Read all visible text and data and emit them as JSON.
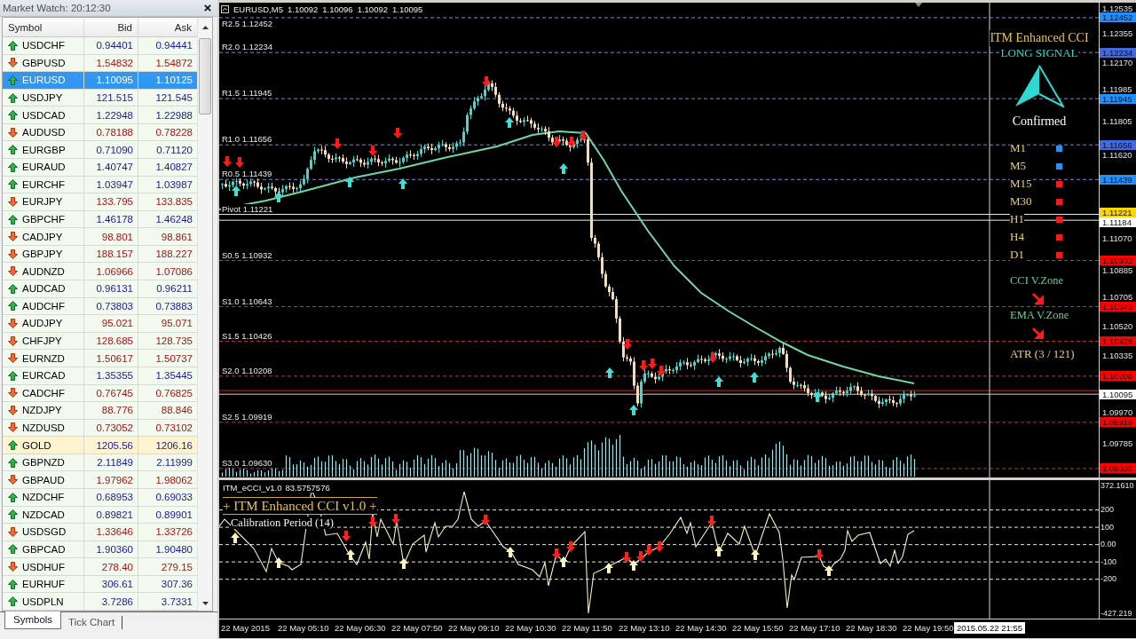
{
  "market_watch": {
    "title": "Market Watch: 20:12:30",
    "columns": [
      "Symbol",
      "Bid",
      "Ask"
    ],
    "rows": [
      {
        "symbol": "USDCHF",
        "bid": "0.94401",
        "ask": "0.94441",
        "rising": true,
        "selected": false,
        "highlighted": false
      },
      {
        "symbol": "GBPUSD",
        "bid": "1.54832",
        "ask": "1.54872",
        "rising": false,
        "selected": false,
        "highlighted": false
      },
      {
        "symbol": "EURUSD",
        "bid": "1.10095",
        "ask": "1.10125",
        "rising": true,
        "selected": true,
        "highlighted": false
      },
      {
        "symbol": "USDJPY",
        "bid": "121.515",
        "ask": "121.545",
        "rising": true,
        "selected": false,
        "highlighted": false
      },
      {
        "symbol": "USDCAD",
        "bid": "1.22948",
        "ask": "1.22988",
        "rising": true,
        "selected": false,
        "highlighted": false
      },
      {
        "symbol": "AUDUSD",
        "bid": "0.78188",
        "ask": "0.78228",
        "rising": false,
        "selected": false,
        "highlighted": false
      },
      {
        "symbol": "EURGBP",
        "bid": "0.71090",
        "ask": "0.71120",
        "rising": true,
        "selected": false,
        "highlighted": false
      },
      {
        "symbol": "EURAUD",
        "bid": "1.40747",
        "ask": "1.40827",
        "rising": true,
        "selected": false,
        "highlighted": false
      },
      {
        "symbol": "EURCHF",
        "bid": "1.03947",
        "ask": "1.03987",
        "rising": true,
        "selected": false,
        "highlighted": false
      },
      {
        "symbol": "EURJPY",
        "bid": "133.795",
        "ask": "133.835",
        "rising": false,
        "selected": false,
        "highlighted": false
      },
      {
        "symbol": "GBPCHF",
        "bid": "1.46178",
        "ask": "1.46248",
        "rising": true,
        "selected": false,
        "highlighted": false
      },
      {
        "symbol": "CADJPY",
        "bid": "98.801",
        "ask": "98.861",
        "rising": false,
        "selected": false,
        "highlighted": false
      },
      {
        "symbol": "GBPJPY",
        "bid": "188.157",
        "ask": "188.227",
        "rising": false,
        "selected": false,
        "highlighted": false
      },
      {
        "symbol": "AUDNZD",
        "bid": "1.06966",
        "ask": "1.07086",
        "rising": false,
        "selected": false,
        "highlighted": false
      },
      {
        "symbol": "AUDCAD",
        "bid": "0.96131",
        "ask": "0.96211",
        "rising": true,
        "selected": false,
        "highlighted": false
      },
      {
        "symbol": "AUDCHF",
        "bid": "0.73803",
        "ask": "0.73883",
        "rising": true,
        "selected": false,
        "highlighted": false
      },
      {
        "symbol": "AUDJPY",
        "bid": "95.021",
        "ask": "95.071",
        "rising": false,
        "selected": false,
        "highlighted": false
      },
      {
        "symbol": "CHFJPY",
        "bid": "128.685",
        "ask": "128.735",
        "rising": false,
        "selected": false,
        "highlighted": false
      },
      {
        "symbol": "EURNZD",
        "bid": "1.50617",
        "ask": "1.50737",
        "rising": false,
        "selected": false,
        "highlighted": false
      },
      {
        "symbol": "EURCAD",
        "bid": "1.35355",
        "ask": "1.35445",
        "rising": true,
        "selected": false,
        "highlighted": false
      },
      {
        "symbol": "CADCHF",
        "bid": "0.76745",
        "ask": "0.76825",
        "rising": false,
        "selected": false,
        "highlighted": false
      },
      {
        "symbol": "NZDJPY",
        "bid": "88.776",
        "ask": "88.846",
        "rising": false,
        "selected": false,
        "highlighted": false
      },
      {
        "symbol": "NZDUSD",
        "bid": "0.73052",
        "ask": "0.73102",
        "rising": false,
        "selected": false,
        "highlighted": false
      },
      {
        "symbol": "GOLD",
        "bid": "1205.56",
        "ask": "1206.16",
        "rising": true,
        "selected": false,
        "highlighted": true
      },
      {
        "symbol": "GBPNZD",
        "bid": "2.11849",
        "ask": "2.11999",
        "rising": true,
        "selected": false,
        "highlighted": false
      },
      {
        "symbol": "GBPAUD",
        "bid": "1.97962",
        "ask": "1.98062",
        "rising": false,
        "selected": false,
        "highlighted": false
      },
      {
        "symbol": "NZDCHF",
        "bid": "0.68953",
        "ask": "0.69033",
        "rising": true,
        "selected": false,
        "highlighted": false
      },
      {
        "symbol": "NZDCAD",
        "bid": "0.89821",
        "ask": "0.89901",
        "rising": true,
        "selected": false,
        "highlighted": false
      },
      {
        "symbol": "USDSGD",
        "bid": "1.33646",
        "ask": "1.33726",
        "rising": false,
        "selected": false,
        "highlighted": false
      },
      {
        "symbol": "GBPCAD",
        "bid": "1.90360",
        "ask": "1.90480",
        "rising": true,
        "selected": false,
        "highlighted": false
      },
      {
        "symbol": "USDHUF",
        "bid": "278.40",
        "ask": "279.15",
        "rising": false,
        "selected": false,
        "highlighted": false
      },
      {
        "symbol": "EURHUF",
        "bid": "306.61",
        "ask": "307.36",
        "rising": true,
        "selected": false,
        "highlighted": false
      },
      {
        "symbol": "USDPLN",
        "bid": "3.7286",
        "ask": "3.7331",
        "rising": true,
        "selected": false,
        "highlighted": false
      }
    ],
    "tabs": [
      {
        "label": "Symbols",
        "selected": true
      },
      {
        "label": "Tick Chart",
        "selected": false
      }
    ]
  },
  "chart": {
    "symbol": "EURUSD,M5",
    "ohlc": [
      "1.10092",
      "1.10096",
      "1.10092",
      "1.10095"
    ],
    "pivot_levels": [
      {
        "label": "R2.5 1.12452",
        "kind": "resistance"
      },
      {
        "label": "R2.0 1.12234",
        "kind": "resistance"
      },
      {
        "label": "R1.5 1.11945",
        "kind": "resistance"
      },
      {
        "label": "R1.0 1.11656",
        "kind": "resistance"
      },
      {
        "label": "R0.5 1.11439",
        "kind": "resistance"
      },
      {
        "label": "Pivot 1.11221",
        "kind": "pivot"
      },
      {
        "label": "S0.5 1.10932",
        "kind": "support"
      },
      {
        "label": "S1.0 1.10643",
        "kind": "support"
      },
      {
        "label": "S1.5 1.10426",
        "kind": "support"
      },
      {
        "label": "S2.0 1.10208",
        "kind": "support"
      },
      {
        "label": "S2.5 1.09919",
        "kind": "support"
      },
      {
        "label": "S3.0 1.09630",
        "kind": "support"
      }
    ],
    "price_axis": {
      "ticks": [
        "1.12535",
        "1.12355",
        "1.12170",
        "1.11985",
        "1.11805",
        "1.11620",
        "1.11070",
        "1.10885",
        "1.10705",
        "1.10520",
        "1.10335",
        "1.09970",
        "1.09785"
      ],
      "markers": [
        {
          "price": "1.12452",
          "kind": "level",
          "color": "#1e90ff"
        },
        {
          "price": "1.12234",
          "kind": "level",
          "color": "#4169e1"
        },
        {
          "price": "1.11945",
          "kind": "level",
          "color": "#1e90ff"
        },
        {
          "price": "1.11656",
          "kind": "level",
          "color": "#4169e1"
        },
        {
          "price": "1.11439",
          "kind": "level",
          "color": "#1e90ff"
        },
        {
          "price": "1.11221",
          "kind": "level",
          "color": "#ffd700"
        },
        {
          "price": "1.11184",
          "kind": "cursor",
          "color": "#ffffff"
        },
        {
          "price": "1.10932",
          "kind": "level",
          "color": "#ff0000"
        },
        {
          "price": "1.10643",
          "kind": "level",
          "color": "#ff0000"
        },
        {
          "price": "1.10426",
          "kind": "level",
          "color": "#ff0000"
        },
        {
          "price": "1.10208",
          "kind": "level",
          "color": "#ff0000"
        },
        {
          "price": "1.10095",
          "kind": "bid",
          "color": "#ffffff"
        },
        {
          "price": "1.09919",
          "kind": "level",
          "color": "#ff0000"
        },
        {
          "price": "1.09630",
          "kind": "level",
          "color": "#ff0000"
        }
      ]
    },
    "signal_panel": {
      "title": "ITM Enhanced CCI",
      "signal": "LONG SIGNAL",
      "status": "Confirmed",
      "timeframes": [
        {
          "label": "M1",
          "color": "#2f8fea"
        },
        {
          "label": "M5",
          "color": "#2f8fea"
        },
        {
          "label": "M15",
          "color": "#f21c1c"
        },
        {
          "label": "M30",
          "color": "#f21c1c"
        },
        {
          "label": "H1",
          "color": "#f21c1c"
        },
        {
          "label": "H4",
          "color": "#f21c1c"
        },
        {
          "label": "D1",
          "color": "#f21c1c"
        }
      ],
      "zones": [
        {
          "label": "CCI V.Zone",
          "rising": false
        },
        {
          "label": "EMA V.Zone",
          "rising": false
        }
      ],
      "atr": "ATR (3 / 121)"
    }
  },
  "indicator_window": {
    "name": "ITM_eCCI_v1.0",
    "value": "83.5757576",
    "title": "+ ITM Enhanced CCI v1.0 +",
    "subtitle": "Calibration Period (14)",
    "axis": [
      "372.1610",
      "200",
      "100",
      "0.00",
      "-100",
      "-200",
      "-427.219"
    ]
  },
  "time_axis": {
    "labels": [
      "22 May 2015",
      "22 May 05:10",
      "22 May 06:30",
      "22 May 07:50",
      "22 May 09:10",
      "22 May 10:30",
      "22 May 11:50",
      "22 May 13:10",
      "22 May 14:30",
      "22 May 15:50",
      "22 May 17:10",
      "22 May 18:30",
      "22 May 19:50"
    ],
    "cursor_time": "2015.05.22 21:55"
  }
}
